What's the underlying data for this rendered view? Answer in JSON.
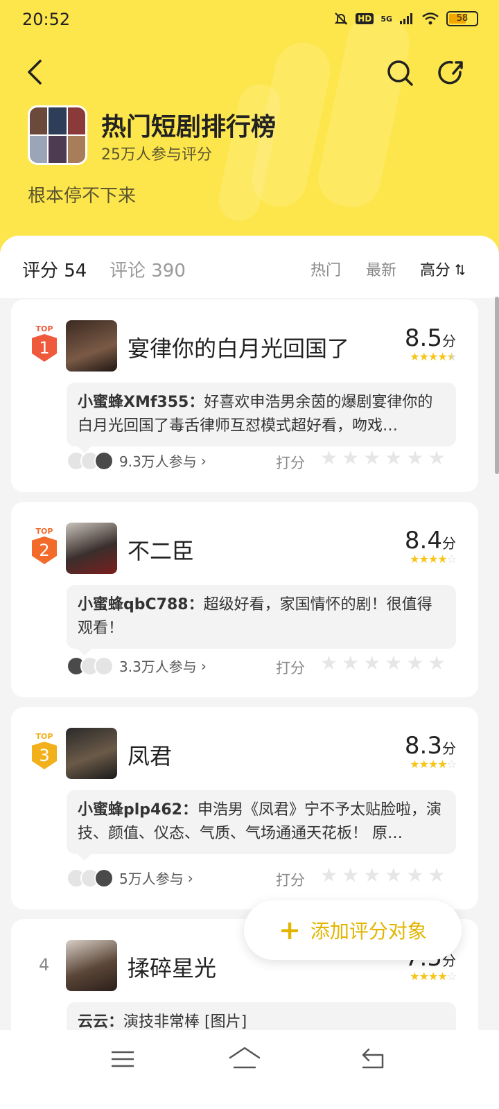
{
  "status_bar": {
    "time": "20:52",
    "network": "5G",
    "battery": "58",
    "battery_level": 0.58
  },
  "header": {
    "title": "热门短剧排行榜",
    "participants": "25万人参与评分",
    "subtitle": "根本停不下来"
  },
  "tabs": {
    "rating_label": "评分 54",
    "comment_label": "评论 390",
    "sort_hot": "热门",
    "sort_new": "最新",
    "sort_high": "高分",
    "sort_icon": "sort-icon"
  },
  "items": [
    {
      "rank": "1",
      "top_label": "TOP",
      "title": "宴律你的白月光回国了",
      "score": "8.5",
      "score_unit": "分",
      "stars": 4.5,
      "commenter": "小蜜蜂XMf355：",
      "comment": "好喜欢申浩男余茵的爆剧宴律你的白月光回国了毒舌律师互怼模式超好看，吻戏…",
      "participants": "9.3万人参与",
      "rate_label": "打分"
    },
    {
      "rank": "2",
      "top_label": "TOP",
      "title": "不二臣",
      "score": "8.4",
      "score_unit": "分",
      "stars": 4,
      "commenter": "小蜜蜂qbC788：",
      "comment": "超级好看，家国情怀的剧！很值得观看！",
      "participants": "3.3万人参与",
      "rate_label": "打分"
    },
    {
      "rank": "3",
      "top_label": "TOP",
      "title": "凤君",
      "score": "8.3",
      "score_unit": "分",
      "stars": 4,
      "commenter": "小蜜蜂plp462：",
      "comment": "申浩男《凤君》宁不予太贴脸啦，演技、颜值、仪态、气质、气场通通天花板！ 原…",
      "participants": "5万人参与",
      "rate_label": "打分"
    },
    {
      "rank": "4",
      "title": "揉碎星光",
      "score": "7.5",
      "score_unit": "分",
      "stars": 4,
      "commenter": "云云：",
      "comment": "演技非常棒 [图片]"
    }
  ],
  "fab": {
    "label": "添加评分对象"
  },
  "colors": {
    "brand_yellow": "#fde64b",
    "accent_gold": "#e3b400",
    "star": "#f5c518",
    "rank1": "#ef5a3c",
    "rank2": "#f26b2a",
    "rank3": "#f2b01b"
  }
}
